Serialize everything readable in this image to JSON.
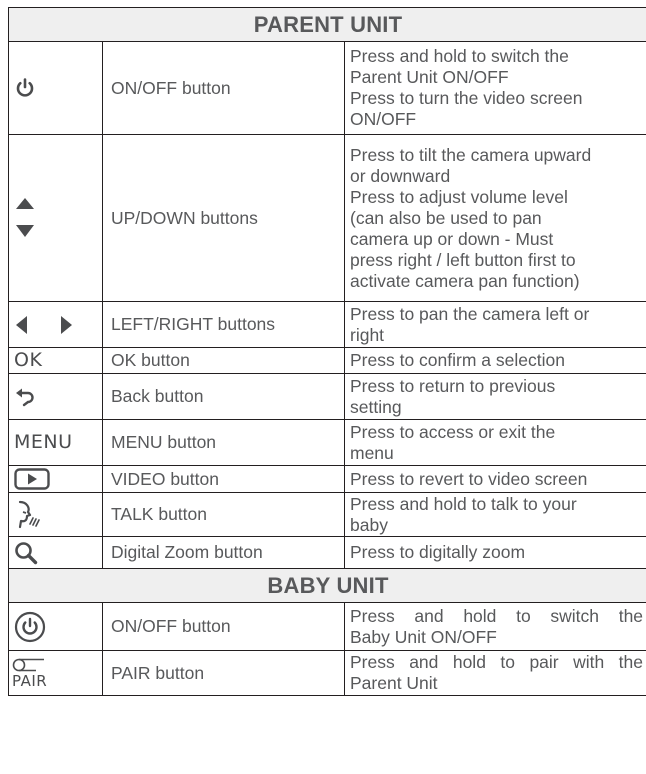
{
  "parent_header": "PARENT UNIT",
  "baby_header": "BABY UNIT",
  "parent_rows": [
    {
      "icon": "power-icon",
      "name": "ON/OFF button",
      "desc": [
        "Press and hold to switch the",
        "Parent Unit ON/OFF",
        "Press to turn the video screen",
        "ON/OFF"
      ]
    },
    {
      "icon": "up-down-arrows-icon",
      "name": "UP/DOWN buttons",
      "desc": [
        "Press to tilt the camera upward",
        "or downward",
        "Press to adjust volume level",
        "(can also be used to pan",
        "camera up or down - Must",
        "press right / left button first to",
        "activate camera pan function)"
      ]
    },
    {
      "icon": "left-right-arrows-icon",
      "name": "LEFT/RIGHT buttons",
      "desc": [
        "Press to pan the camera left or",
        "right"
      ]
    },
    {
      "icon": "ok-icon",
      "icon_text": "OK",
      "name": "OK button",
      "desc": [
        "Press to confirm a selection"
      ]
    },
    {
      "icon": "back-arrow-icon",
      "name": "Back button",
      "desc": [
        "Press to return to previous",
        "setting"
      ]
    },
    {
      "icon": "menu-icon",
      "icon_text": "MENU",
      "name": "MENU button",
      "desc": [
        "Press to access or exit the",
        "menu"
      ]
    },
    {
      "icon": "video-play-icon",
      "name": "VIDEO button",
      "desc": [
        "Press to revert to video screen"
      ]
    },
    {
      "icon": "talk-icon",
      "name": "TALK button",
      "desc": [
        "Press and hold to talk to your",
        "baby"
      ]
    },
    {
      "icon": "zoom-magnifier-icon",
      "name": "Digital Zoom button",
      "desc": [
        "Press to digitally zoom"
      ]
    }
  ],
  "baby_rows": [
    {
      "icon": "power-circle-icon",
      "name": "ON/OFF button",
      "desc": [
        "Press and hold to switch the",
        "Baby Unit ON/OFF"
      ]
    },
    {
      "icon": "pair-icon",
      "icon_text": "PAIR",
      "name": "PAIR button",
      "desc": [
        "Press and hold to pair with the",
        "Parent Unit"
      ]
    }
  ]
}
